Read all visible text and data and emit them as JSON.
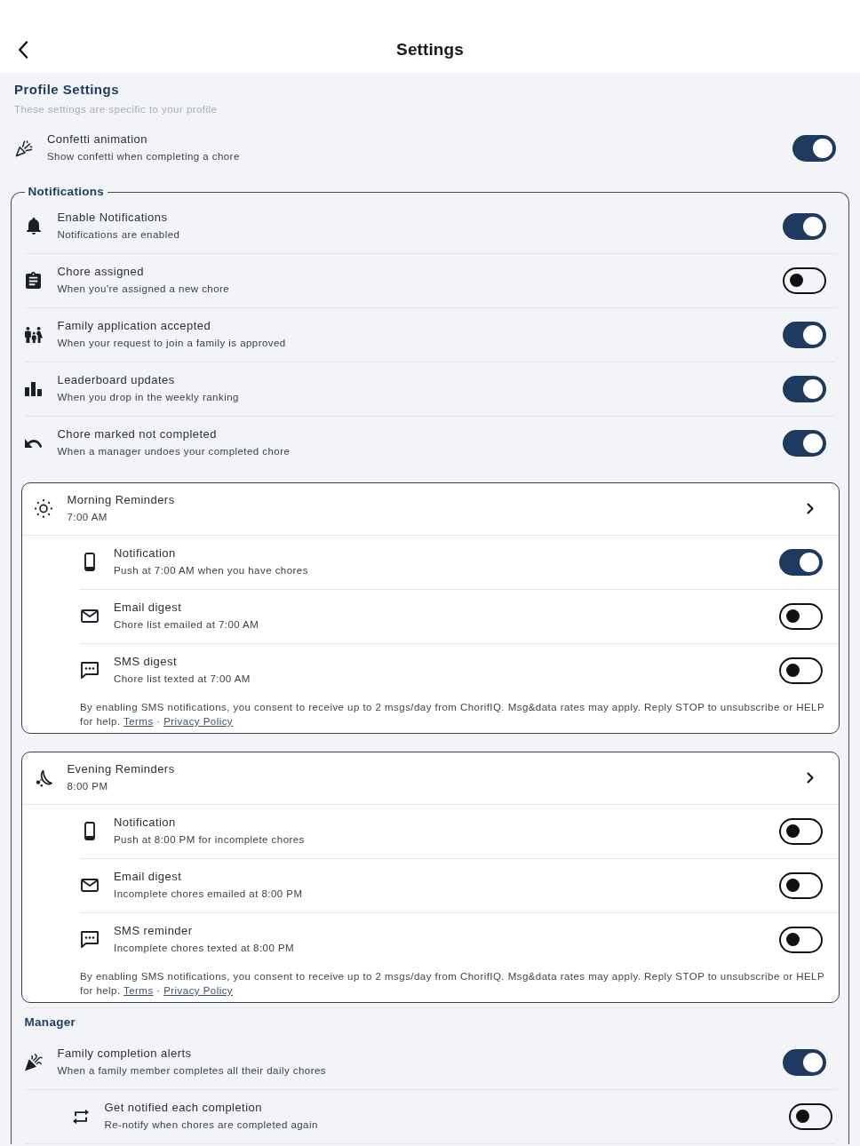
{
  "header": {
    "title": "Settings"
  },
  "profile": {
    "heading": "Profile Settings",
    "subtitle": "These settings are specific to your profile",
    "items": [
      {
        "title": "Confetti animation",
        "subtitle": "Show confetti when completing a chore",
        "on": true
      }
    ]
  },
  "notifications": {
    "legend": "Notifications",
    "items": [
      {
        "title": "Enable Notifications",
        "subtitle": "Notifications are enabled",
        "on": true
      },
      {
        "title": "Chore assigned",
        "subtitle": "When you're assigned a new chore",
        "on": false
      },
      {
        "title": "Family application accepted",
        "subtitle": "When your request to join a family is approved",
        "on": true
      },
      {
        "title": "Leaderboard updates",
        "subtitle": "When you drop in the weekly ranking",
        "on": true
      },
      {
        "title": "Chore marked not completed",
        "subtitle": "When a manager undoes your completed chore",
        "on": true
      }
    ],
    "reminders": [
      {
        "title": "Morning Reminders",
        "time": "7:00 AM",
        "items": [
          {
            "title": "Notification",
            "subtitle": "Push at 7:00 AM when you have chores",
            "on": true
          },
          {
            "title": "Email digest",
            "subtitle": "Chore list emailed at 7:00 AM",
            "on": false
          },
          {
            "title": "SMS digest",
            "subtitle": "Chore list texted at 7:00 AM",
            "on": false
          }
        ],
        "consent": {
          "text": "By enabling SMS notifications, you consent to receive up to 2 msgs/day from ChorifIQ. Msg&data rates may apply. Reply STOP to unsubscribe or HELP for help.",
          "links": [
            "Terms",
            "Privacy Policy"
          ],
          "separator": "·"
        }
      },
      {
        "title": "Evening Reminders",
        "time": "8:00 PM",
        "items": [
          {
            "title": "Notification",
            "subtitle": "Push at 8:00 PM for incomplete chores",
            "on": false
          },
          {
            "title": "Email digest",
            "subtitle": "Incomplete chores emailed at 8:00 PM",
            "on": false
          },
          {
            "title": "SMS reminder",
            "subtitle": "Incomplete chores texted at 8:00 PM",
            "on": false
          }
        ],
        "consent": {
          "text": "By enabling SMS notifications, you consent to receive up to 2 msgs/day from ChorifIQ. Msg&data rates may apply. Reply STOP to unsubscribe or HELP for help.",
          "links": [
            "Terms",
            "Privacy Policy"
          ],
          "separator": "·"
        }
      }
    ],
    "manager": {
      "heading": "Manager",
      "items": [
        {
          "title": "Family completion alerts",
          "subtitle": "When a family member completes all their daily chores",
          "on": true,
          "children": [
            {
              "title": "Get notified each completion",
              "subtitle": "Re-notify when chores are completed again",
              "on": false
            }
          ]
        }
      ]
    }
  }
}
